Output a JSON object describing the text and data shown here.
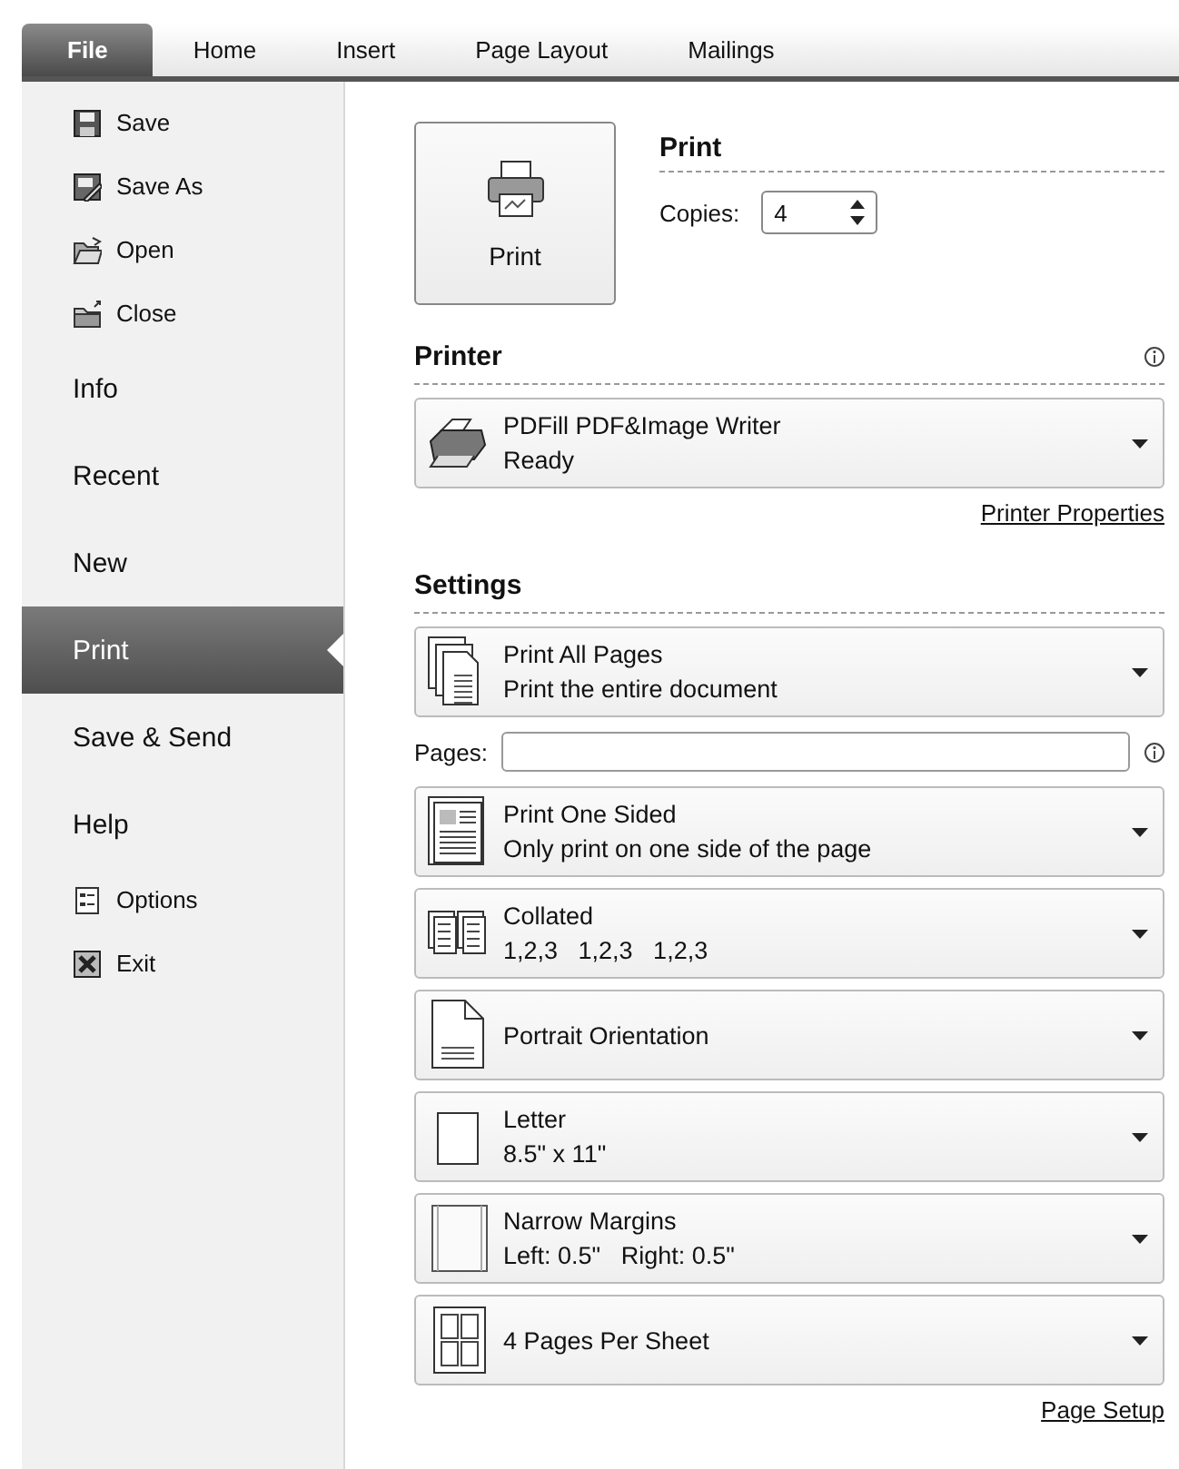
{
  "tabs": [
    {
      "label": "File",
      "selected": true
    },
    {
      "label": "Home",
      "selected": false
    },
    {
      "label": "Insert",
      "selected": false
    },
    {
      "label": "Page Layout",
      "selected": false
    },
    {
      "label": "Mailings",
      "selected": false
    }
  ],
  "sidebar": {
    "items": [
      {
        "kind": "save",
        "label": "Save",
        "selected": false
      },
      {
        "kind": "save-as",
        "label": "Save As",
        "selected": false
      },
      {
        "kind": "open",
        "label": "Open",
        "selected": false
      },
      {
        "kind": "close",
        "label": "Close",
        "selected": false
      },
      {
        "kind": "section",
        "label": "Info",
        "selected": false
      },
      {
        "kind": "section",
        "label": "Recent",
        "selected": false
      },
      {
        "kind": "section",
        "label": "New",
        "selected": false
      },
      {
        "kind": "section",
        "label": "Print",
        "selected": true
      },
      {
        "kind": "section",
        "label": "Save & Send",
        "selected": false
      },
      {
        "kind": "section",
        "label": "Help",
        "selected": false
      },
      {
        "kind": "options",
        "label": "Options",
        "selected": false
      },
      {
        "kind": "exit",
        "label": "Exit",
        "selected": false
      }
    ]
  },
  "print": {
    "button": "Print",
    "heading": "Print",
    "copies_label": "Copies:",
    "copies": "4"
  },
  "printer": {
    "heading": "Printer",
    "name": "PDFill PDF&Image Writer",
    "status": "Ready",
    "properties_link": "Printer Properties"
  },
  "settings": {
    "heading": "Settings",
    "items": [
      {
        "kind": "pages",
        "title": "Print All Pages",
        "subtitle": "Print the entire document"
      },
      {
        "kind": "pages-field",
        "label": "Pages:"
      },
      {
        "kind": "sides",
        "title": "Print One Sided",
        "subtitle": "Only print on one side of the page"
      },
      {
        "kind": "collate",
        "title": "Collated",
        "subtitle": "1,2,3   1,2,3   1,2,3"
      },
      {
        "kind": "orientation",
        "title": "Portrait Orientation"
      },
      {
        "kind": "paper",
        "title": "Letter",
        "subtitle": "8.5\" x 11\""
      },
      {
        "kind": "margins",
        "title": "Narrow Margins",
        "subtitle": "Left: 0.5\"   Right: 0.5\""
      },
      {
        "kind": "per-sheet",
        "title": "4 Pages Per Sheet"
      }
    ],
    "page_setup_link": "Page Setup"
  }
}
